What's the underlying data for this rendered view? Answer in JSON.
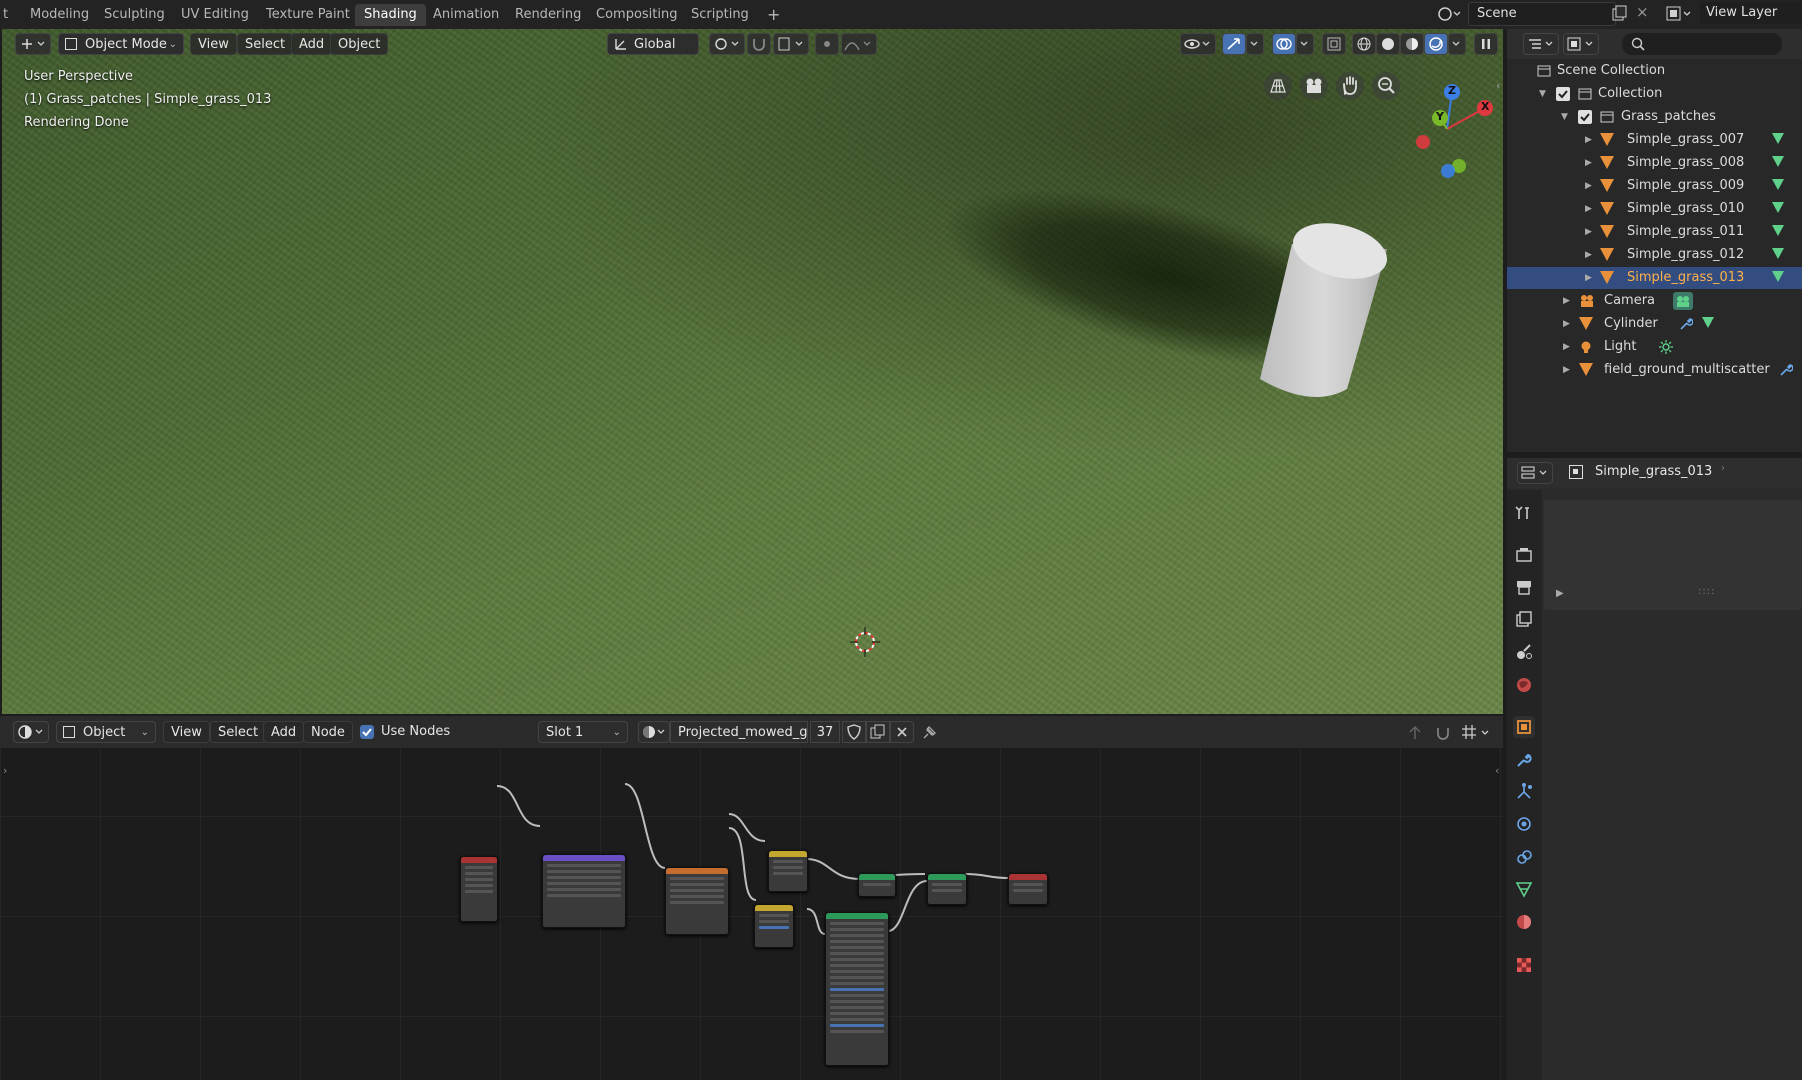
{
  "topbar": {
    "tabs": [
      "t",
      "Modeling",
      "Sculpting",
      "UV Editing",
      "Texture Paint",
      "Shading",
      "Animation",
      "Rendering",
      "Compositing",
      "Scripting"
    ],
    "add_tab": "+",
    "scene": "Scene",
    "view_layer": "View Layer"
  },
  "viewport": {
    "mode": "Object Mode",
    "menus": [
      "View",
      "Select",
      "Add",
      "Object"
    ],
    "transform": "Global",
    "overlay_lines": [
      "User Perspective",
      "(1) Grass_patches | Simple_grass_013",
      "Rendering Done"
    ],
    "gizmo": {
      "x": "X",
      "y": "Y",
      "z": "Z"
    }
  },
  "outliner": {
    "root": "Scene Collection",
    "items": [
      {
        "label": "Collection",
        "depth": 1
      },
      {
        "label": "Grass_patches",
        "depth": 2
      },
      {
        "label": "Simple_grass_007",
        "depth": 3
      },
      {
        "label": "Simple_grass_008",
        "depth": 3
      },
      {
        "label": "Simple_grass_009",
        "depth": 3
      },
      {
        "label": "Simple_grass_010",
        "depth": 3
      },
      {
        "label": "Simple_grass_011",
        "depth": 3
      },
      {
        "label": "Simple_grass_012",
        "depth": 3
      },
      {
        "label": "Simple_grass_013",
        "depth": 3,
        "selected": true
      },
      {
        "label": "Camera",
        "depth": 2
      },
      {
        "label": "Cylinder",
        "depth": 2
      },
      {
        "label": "Light",
        "depth": 2
      },
      {
        "label": "field_ground_multiscatter",
        "depth": 2
      }
    ]
  },
  "properties": {
    "object_name": "Simple_grass_013"
  },
  "node_editor": {
    "object_label": "Object",
    "menus": [
      "View",
      "Select",
      "Add",
      "Node"
    ],
    "use_nodes": "Use Nodes",
    "slot": "Slot 1",
    "material": "Projected_mowed_g...",
    "users": "37"
  },
  "colors": {
    "accent": "#4772b3",
    "selection": "#334d80",
    "selected_text": "#ffb14a",
    "mesh": "#e8913a",
    "vertex_group": "#5fd18a"
  }
}
